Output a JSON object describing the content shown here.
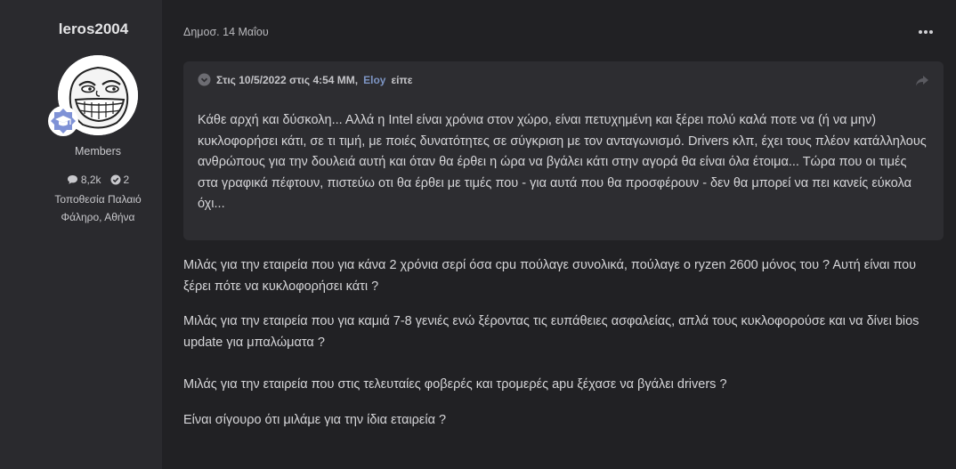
{
  "author": {
    "username": "leros2004",
    "group": "Members",
    "posts_count": "8,2k",
    "solutions_count": "2",
    "location_line1": "Τοποθεσία Παλαιό",
    "location_line2": "Φάληρο, Αθήνα"
  },
  "post": {
    "date": "Δημοσ. 14 Μαΐου",
    "quote": {
      "prefix": "Στις 10/5/2022 στις 4:54 ΜΜ,",
      "user": "Eloy",
      "suffix": "είπε",
      "text": "Κάθε αρχή και δύσκολη... Αλλά η Intel είναι χρόνια στον χώρο, είναι πετυχημένη και ξέρει πολύ καλά ποτε να (ή να μην) κυκλοφορήσει κάτι, σε τι τιμή, με ποιές δυνατότητες σε σύγκριση με τον ανταγωνισμό. Drivers κλπ, έχει τους πλέον κατάλληλους ανθρώπους για την δουλειά αυτή και όταν θα έρθει η ώρα να βγάλει κάτι στην αγορά θα είναι όλα έτοιμα... Τώρα που οι τιμές στα γραφικά πέφτουν, πιστεύω οτι θα έρθει με τιμές που - για αυτά που θα προσφέρουν - δεν θα μπορεί να πει κανείς εύκολα όχι..."
    },
    "paragraphs": [
      "Μιλάς για την εταιρεία που για κάνα 2 χρόνια σερί όσα cpu πούλαγε συνολικά,  πούλαγε ο ryzen 2600 μόνος του ? Αυτή είναι που ξέρει πότε να κυκλοφορήσει κάτι ?",
      "Μιλάς για την εταιρεία που για καμιά 7-8 γενιές ενώ ξέροντας τις ευπάθειες ασφαλείας, απλά τους κυκλοφορούσε και να δίνει bios update για μπαλώματα ?",
      "Μιλάς για την εταιρεία που στις τελευταίες φοβερές και τρομερές apu ξέχασε να βγάλει drivers ?",
      "Είναι σίγουρο ότι μιλάμε για την ίδια εταιρεία ?"
    ]
  },
  "icons": {
    "posts": "comment-icon",
    "solutions": "check-circle-icon",
    "quote_toggle": "chevron-circle-icon",
    "share": "share-icon",
    "rank": "graduation-cap-icon",
    "more": "more-dots-icon"
  },
  "colors": {
    "background": "#212124",
    "sidebar": "#2a2a2e",
    "quote_box": "#2d2d31",
    "quote_user_link": "#7d95c4",
    "rank_badge": "#7f92d6"
  }
}
